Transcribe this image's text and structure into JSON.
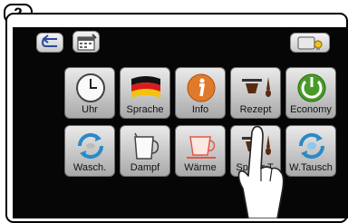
{
  "step_label": "2",
  "toolbar": {
    "back_icon": "back-arrow-icon",
    "calendar_icon": "calendar-wrench-icon",
    "settings_icon": "card-settings-icon"
  },
  "menu": {
    "row1": [
      {
        "label": "Uhr",
        "icon": "clock-icon"
      },
      {
        "label": "Sprache",
        "icon": "german-flag-icon"
      },
      {
        "label": "Info",
        "icon": "info-icon"
      },
      {
        "label": "Rezept",
        "icon": "recipe-cup-icon"
      },
      {
        "label": "Economy",
        "icon": "eco-power-icon"
      }
    ],
    "row2": [
      {
        "label": "Wasch.",
        "icon": "wash-cycle-icon"
      },
      {
        "label": "Dampf",
        "icon": "steam-jug-icon"
      },
      {
        "label": "Wärme",
        "icon": "cup-warmer-icon"
      },
      {
        "label": "Spüler T.",
        "icon": "rinse-cup-icon"
      },
      {
        "label": "W.Tausch",
        "icon": "water-exchange-icon"
      }
    ]
  },
  "colors": {
    "screen": "#060606",
    "tile": "#c8c8c8",
    "accent_orange": "#e07a2a",
    "accent_green": "#4a9a2a",
    "accent_blue": "#2a8ac8"
  }
}
